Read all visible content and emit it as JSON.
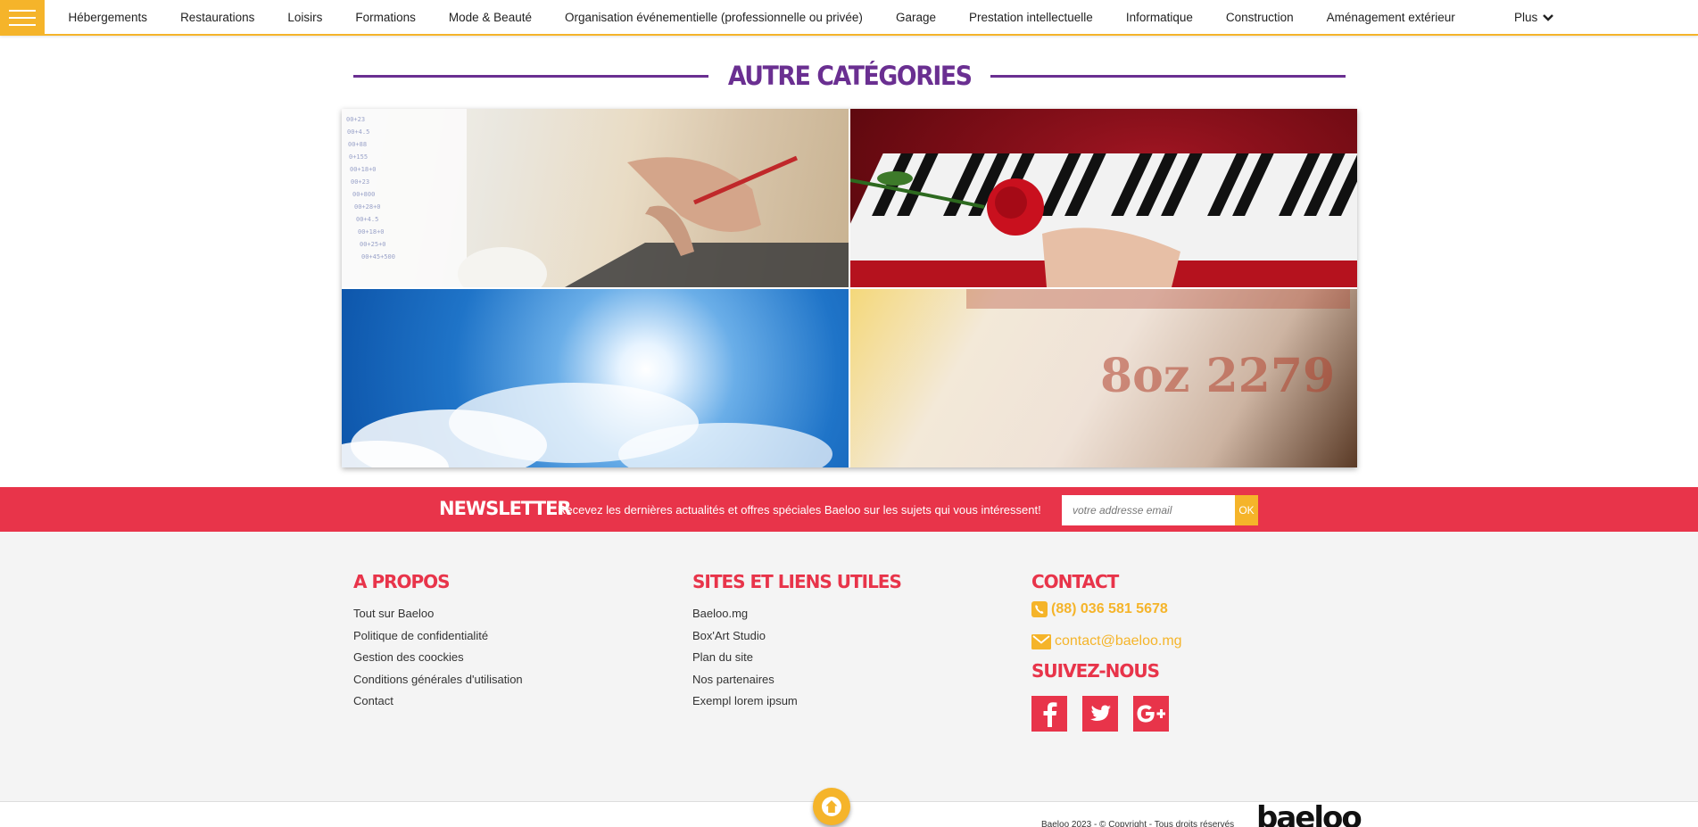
{
  "nav": {
    "menu_icon": "hamburger-icon",
    "items": [
      {
        "label": "Hébergements"
      },
      {
        "label": "Restaurations"
      },
      {
        "label": "Loisirs"
      },
      {
        "label": "Formations"
      },
      {
        "label": "Mode & Beauté"
      },
      {
        "label": "Organisation événementielle (professionnelle ou privée)"
      },
      {
        "label": "Garage"
      },
      {
        "label": "Prestation intellectuelle"
      },
      {
        "label": "Informatique"
      },
      {
        "label": "Construction"
      },
      {
        "label": "Aménagement extérieur"
      }
    ],
    "more_label": "Plus",
    "more_icon": "chevron-down-icon"
  },
  "section": {
    "title": "AUTRE CATÉGORIES"
  },
  "newsletter": {
    "title": "NEWSLETTER",
    "text": "Recevez les dernières actualités et offres spéciales Baeloo sur les sujets qui vous intéressent!",
    "placeholder": "votre addresse email",
    "button": "OK"
  },
  "footer": {
    "about": {
      "title": "A PROPOS",
      "links": [
        "Tout sur Baeloo",
        "Politique de confidentialité",
        "Gestion des coockies",
        "Conditions générales d'utilisation",
        "Contact"
      ]
    },
    "useful": {
      "title": "SITES ET LIENS UTILES",
      "links": [
        "Baeloo.mg",
        "Box'Art Studio",
        "Plan du site",
        "Nos partenaires",
        "Exempl lorem ipsum"
      ]
    },
    "contact": {
      "title": "CONTACT",
      "phone": "(88) 036 581 5678",
      "email": "contact@baeloo.mg",
      "follow_title": "SUIVEZ-NOUS",
      "social_icons": [
        "facebook-icon",
        "twitter-icon",
        "google-plus-icon"
      ]
    }
  },
  "bottom": {
    "copyright": "Baeloo 2023 - © Copyright - Tous droits réservés",
    "logo": "baeloo",
    "scroll_icon": "arrow-up-icon"
  },
  "colors": {
    "accent_yellow": "#f5b42a",
    "brand_red": "#e8344a",
    "title_purple": "#6a2f91"
  }
}
